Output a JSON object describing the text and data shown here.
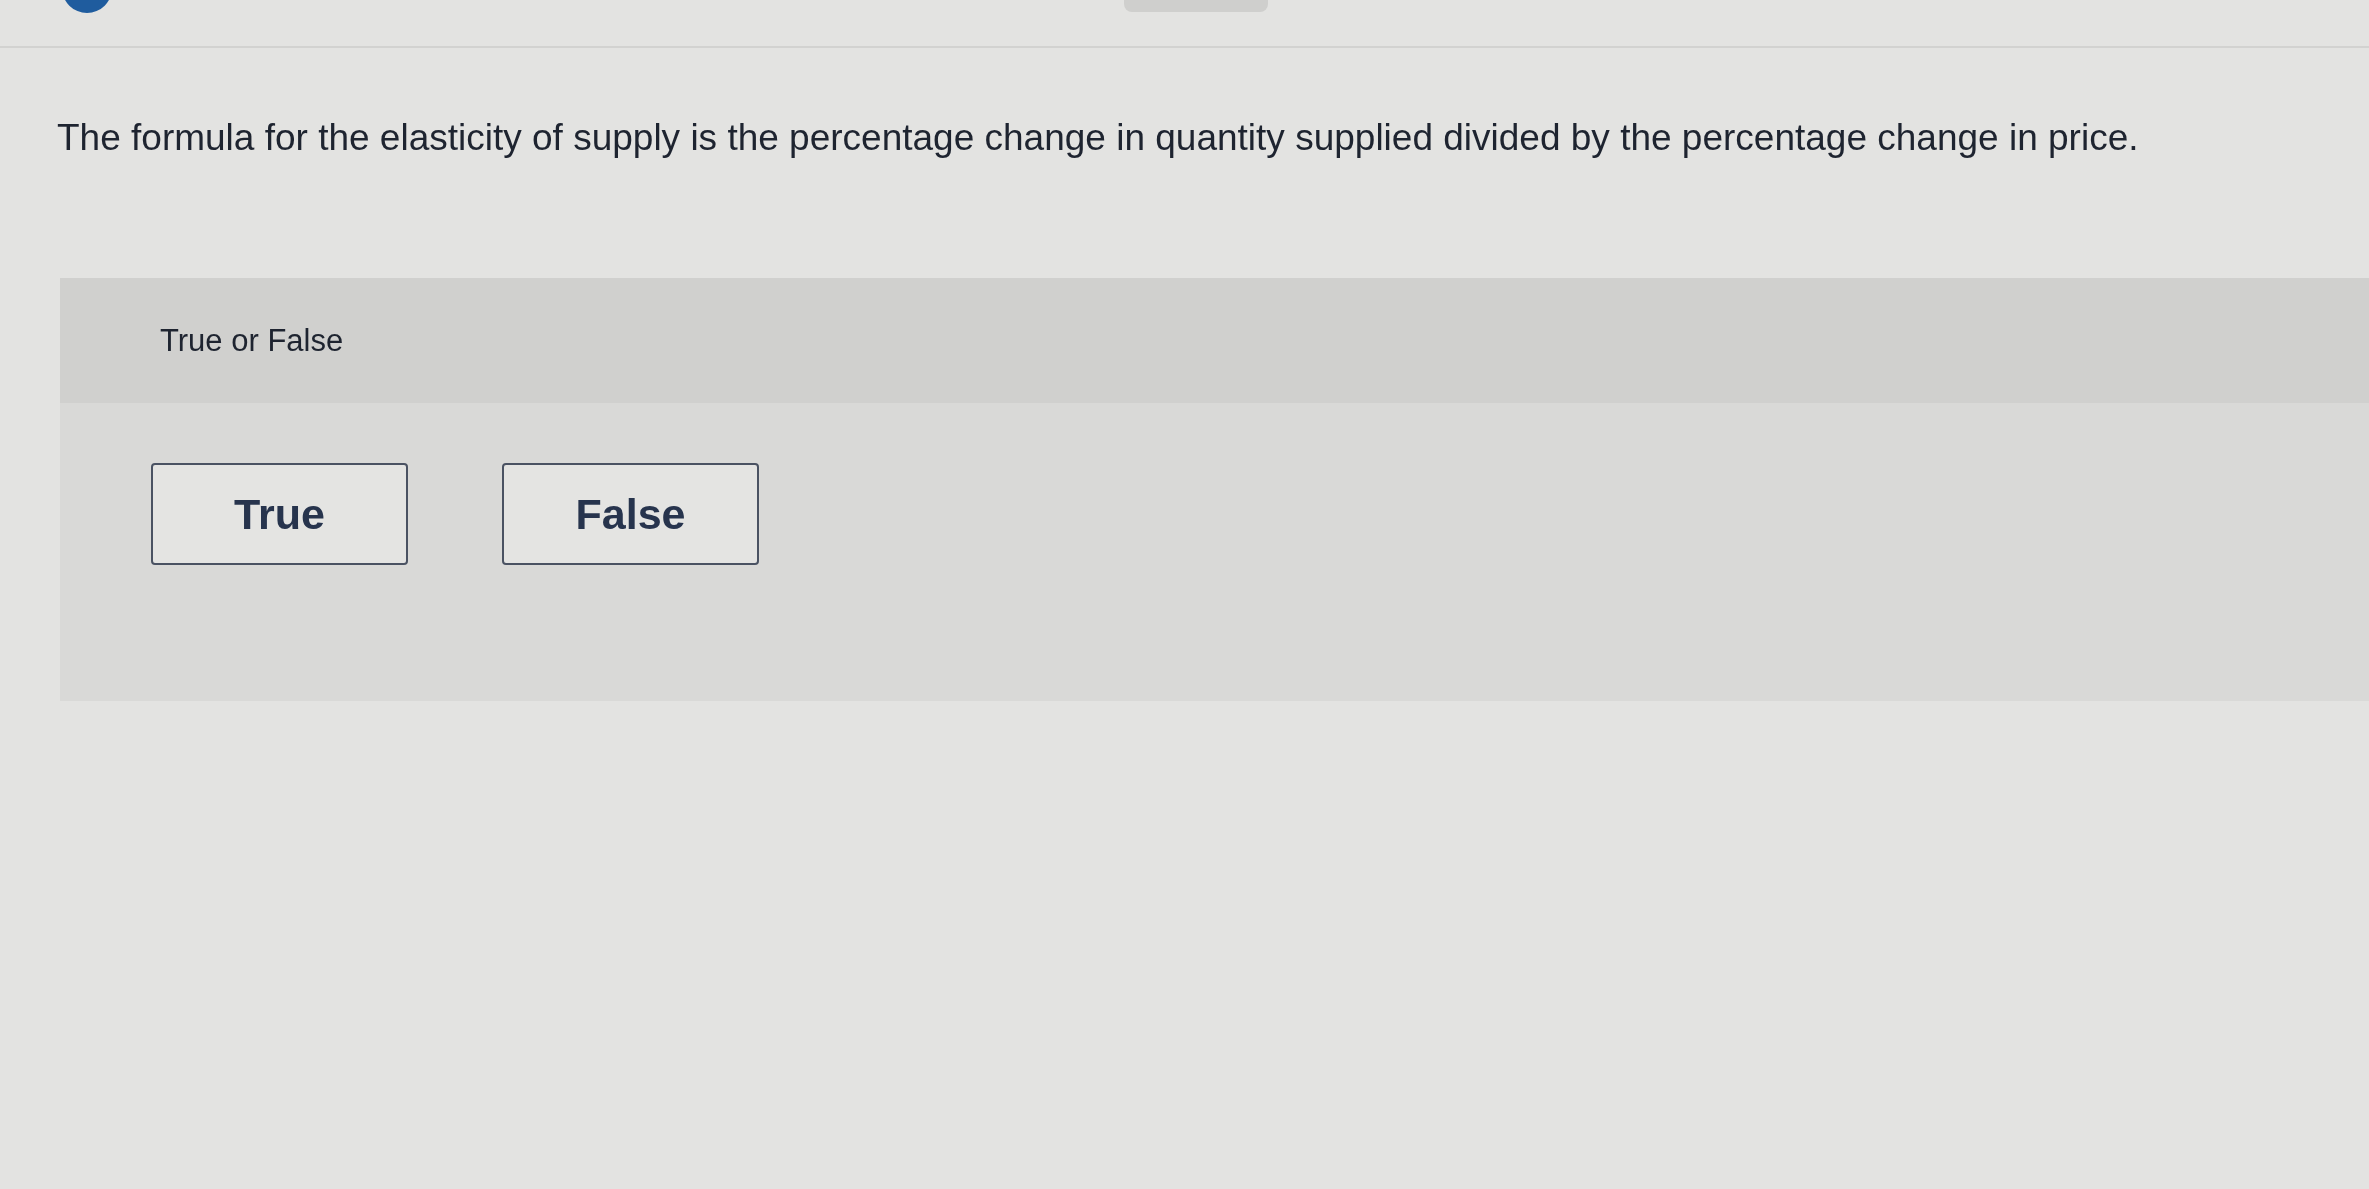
{
  "question": {
    "text": "The formula for the elasticity of supply is the percentage change in quantity supplied divided by the percentage change in price."
  },
  "answer_panel": {
    "prompt": "True or False",
    "options": [
      {
        "label": "True",
        "selected": false
      },
      {
        "label": "False",
        "selected": false
      }
    ]
  }
}
